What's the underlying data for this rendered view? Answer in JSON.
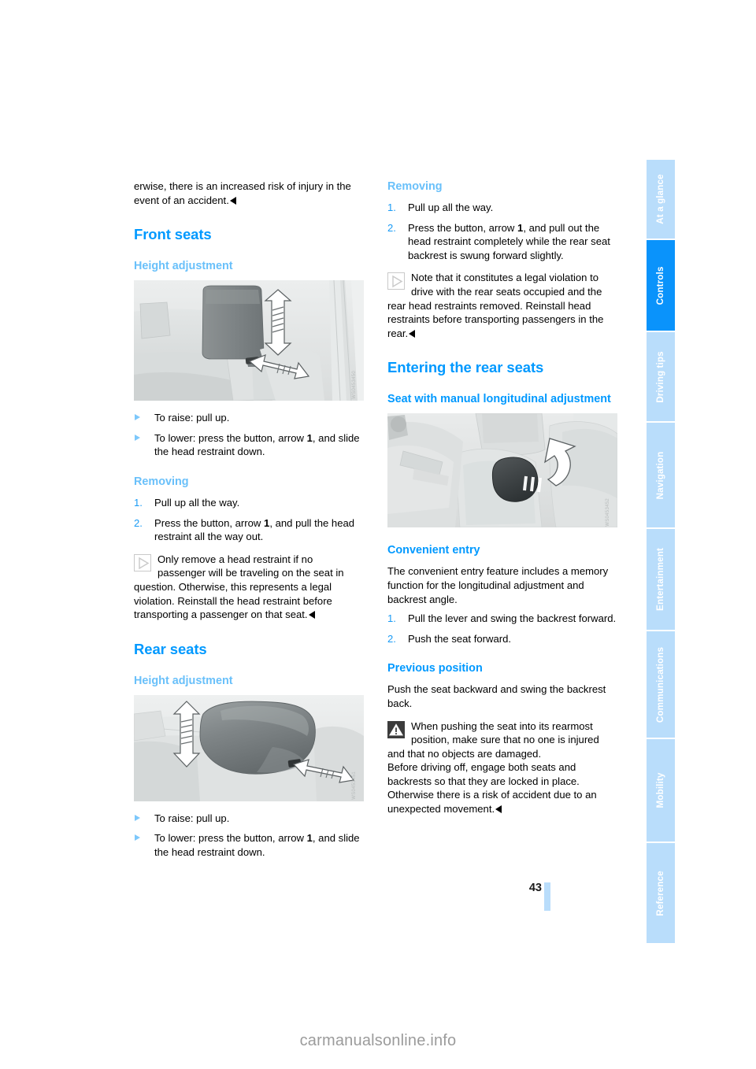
{
  "page": {
    "number": "43",
    "watermark": "carmanualsonline.info"
  },
  "sidebar": {
    "tabs": [
      {
        "label": "At a glance",
        "active": false
      },
      {
        "label": "Controls",
        "active": true
      },
      {
        "label": "Driving tips",
        "active": false
      },
      {
        "label": "Navigation",
        "active": false
      },
      {
        "label": "Entertainment",
        "active": false
      },
      {
        "label": "Communications",
        "active": false
      },
      {
        "label": "Mobility",
        "active": false
      },
      {
        "label": "Reference",
        "active": false
      }
    ],
    "active_color": "#0a93fb",
    "inactive_color": "#b9ddfb"
  },
  "left_column": {
    "continued_paragraph": "erwise, there is an increased risk of injury in the event of an accident.",
    "front_seats_heading": "Front seats",
    "height_adjustment_heading": "Height adjustment",
    "figure1_caption": "WS0453450",
    "front_bullets": [
      "To raise: pull up.",
      "To lower: press the button, arrow 1, and slide the head restraint down."
    ],
    "removing_heading": "Removing",
    "removing_steps": [
      {
        "num": "1.",
        "text": "Pull up all the way."
      },
      {
        "num": "2.",
        "text": "Press the button, arrow 1, and pull the head restraint all the way out."
      }
    ],
    "note_text": "Only remove a head restraint if no passenger will be traveling on the seat in question. Otherwise, this represents a legal violation. Reinstall the head restraint before transporting a passenger on that seat.",
    "rear_seats_heading": "Rear seats",
    "rear_height_heading": "Height adjustment",
    "figure2_caption": "WS0453451",
    "rear_bullets": [
      "To raise: pull up.",
      "To lower: press the button, arrow 1, and slide the head restraint down."
    ]
  },
  "right_column": {
    "removing_heading": "Removing",
    "removing_steps": [
      {
        "num": "1.",
        "text": "Pull up all the way."
      },
      {
        "num": "2.",
        "text": "Press the button, arrow 1, and pull out the head restraint completely while the rear seat backrest is swung forward slightly."
      }
    ],
    "note_text": "Note that it constitutes a legal violation to drive with the rear seats occupied and the rear head restraints removed. Reinstall head restraints before transporting passengers in the rear.",
    "entering_heading": "Entering the rear seats",
    "manual_adjust_heading": "Seat with manual longitudinal adjustment",
    "figure3_caption": "WS0453452",
    "convenient_entry_heading": "Convenient entry",
    "convenient_entry_body": "The convenient entry feature includes a memory function for the longitudinal adjustment and backrest angle.",
    "convenient_steps": [
      {
        "num": "1.",
        "text": "Pull the lever and swing the backrest forward."
      },
      {
        "num": "2.",
        "text": "Push the seat forward."
      }
    ],
    "previous_position_heading": "Previous position",
    "previous_position_body": "Push the seat backward and swing the backrest back.",
    "warning_text_1": "When pushing the seat into its rearmost position, make sure that no one is injured and that no objects are damaged.",
    "warning_text_2": "Before driving off, engage both seats and backrests so that they are locked in place. Otherwise there is a risk of accident due to an unexpected movement."
  },
  "theme": {
    "heading_blue": "#0099ff",
    "subheading_blue": "#69c0fa",
    "list_number_blue": "#1a9bf5",
    "text_black": "#000000"
  }
}
